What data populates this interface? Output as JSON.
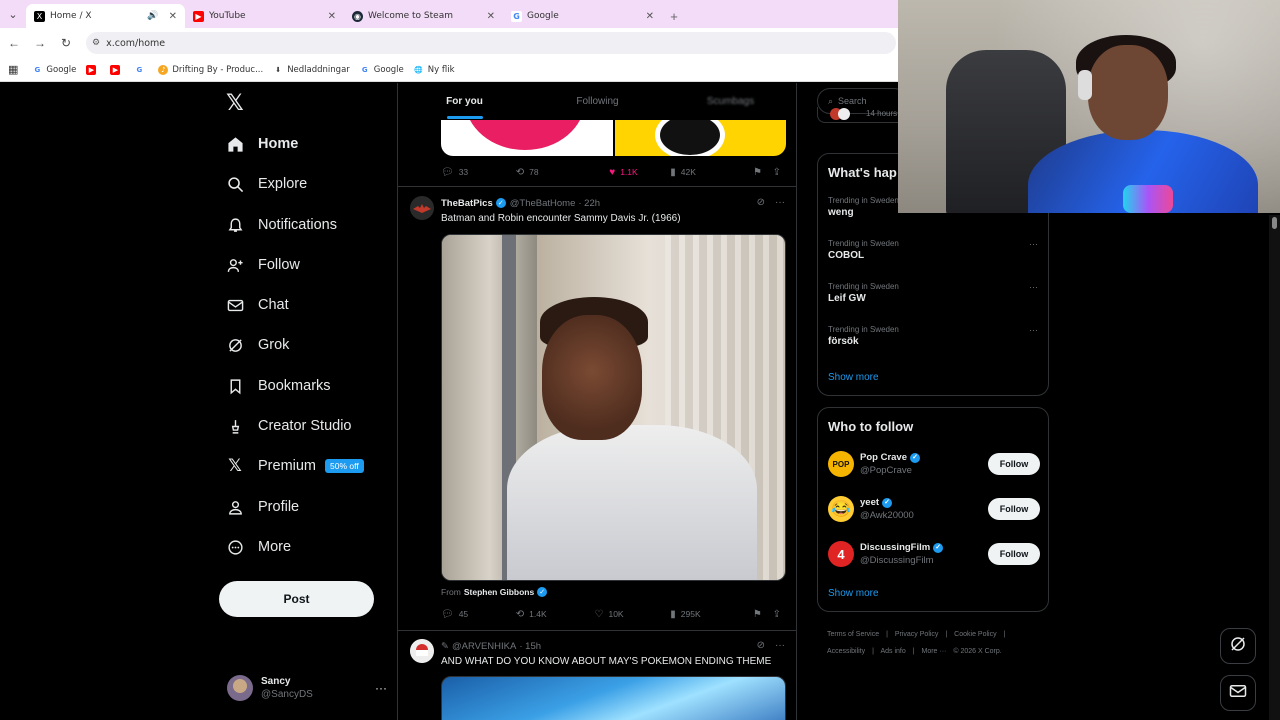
{
  "browser": {
    "tabs": [
      {
        "title": "Home / X",
        "favicon": "x-logo",
        "active": true,
        "audio": true
      },
      {
        "title": "YouTube",
        "favicon": "youtube-logo",
        "active": false
      },
      {
        "title": "Welcome to Steam",
        "favicon": "steam-logo",
        "active": false
      },
      {
        "title": "Google",
        "favicon": "google-logo",
        "active": false
      }
    ],
    "url": "x.com/home",
    "bookmarks": [
      {
        "label": "Google",
        "icon": "google-logo"
      },
      {
        "label": "",
        "icon": "youtube-logo"
      },
      {
        "label": "",
        "icon": "youtube-logo"
      },
      {
        "label": "",
        "icon": "google-logo"
      },
      {
        "label": "Drifting By - Produc...",
        "icon": "music-logo"
      },
      {
        "label": "Nedladdningar",
        "icon": "download-icon"
      },
      {
        "label": "Google",
        "icon": "google-logo"
      },
      {
        "label": "Ny flik",
        "icon": "globe-icon"
      }
    ]
  },
  "nav": {
    "items": [
      {
        "label": "Home",
        "icon": "home-icon"
      },
      {
        "label": "Explore",
        "icon": "search-icon"
      },
      {
        "label": "Notifications",
        "icon": "bell-icon"
      },
      {
        "label": "Follow",
        "icon": "follow-icon"
      },
      {
        "label": "Chat",
        "icon": "mail-icon"
      },
      {
        "label": "Grok",
        "icon": "grok-icon"
      },
      {
        "label": "Bookmarks",
        "icon": "bookmark-icon"
      },
      {
        "label": "Creator Studio",
        "icon": "creator-icon"
      },
      {
        "label": "Premium",
        "icon": "x-icon"
      },
      {
        "label": "Profile",
        "icon": "profile-icon"
      },
      {
        "label": "More",
        "icon": "more-icon"
      }
    ],
    "premium_badge": "50% off",
    "post_button": "Post",
    "account": {
      "name": "Sancy",
      "handle": "@SancyDS"
    }
  },
  "feed": {
    "tabs": [
      "For you",
      "Following",
      "Scumbags"
    ],
    "prev_post_stats": {
      "replies": "33",
      "reposts": "78",
      "likes": "1.1K",
      "views": "42K"
    },
    "post1": {
      "name": "TheBatPics",
      "handle": "@TheBatHome",
      "time": "· 22h",
      "text": "Batman and Robin encounter Sammy Davis Jr. (1966)",
      "from_label": "From",
      "from_name": "Stephen Gibbons",
      "stats": {
        "replies": "45",
        "reposts": "1.4K",
        "likes": "10K",
        "views": "295K"
      }
    },
    "post2": {
      "name": "",
      "handle": "@ARVENHIKA",
      "time": "· 15h",
      "text": "AND WHAT DO YOU KNOW ABOUT MAY'S POKEMON ENDING THEME"
    }
  },
  "sidebar": {
    "search_placeholder": "Search",
    "top_timestamp": "14 hours",
    "whats_happening": "What's hap",
    "trends": [
      {
        "context": "Trending in Sweden",
        "name": "weng"
      },
      {
        "context": "Trending in Sweden",
        "name": "COBOL"
      },
      {
        "context": "Trending in Sweden",
        "name": "Leif GW"
      },
      {
        "context": "Trending in Sweden",
        "name": "försök"
      }
    ],
    "show_more": "Show more",
    "who_to_follow": "Who to follow",
    "suggestions": [
      {
        "name": "Pop Crave",
        "handle": "@PopCrave",
        "button": "Follow",
        "avatar_text": "POP",
        "color": "#f5b400"
      },
      {
        "name": "yeet",
        "handle": "@Awk20000",
        "button": "Follow",
        "avatar_text": "😂",
        "color": "#ffcc33"
      },
      {
        "name": "DiscussingFilm",
        "handle": "@DiscussingFilm",
        "button": "Follow",
        "avatar_text": "4",
        "color": "#e02424"
      }
    ],
    "show_more_2": "Show more",
    "footer": [
      "Terms of Service",
      "|",
      "Privacy Policy",
      "|",
      "Cookie Policy",
      "|",
      "Accessibility",
      "|",
      "Ads info",
      "|",
      "More ···",
      "© 2026 X Corp."
    ]
  },
  "colors": {
    "accent": "#1d9bf0",
    "like": "#f91880",
    "background": "#000000"
  }
}
